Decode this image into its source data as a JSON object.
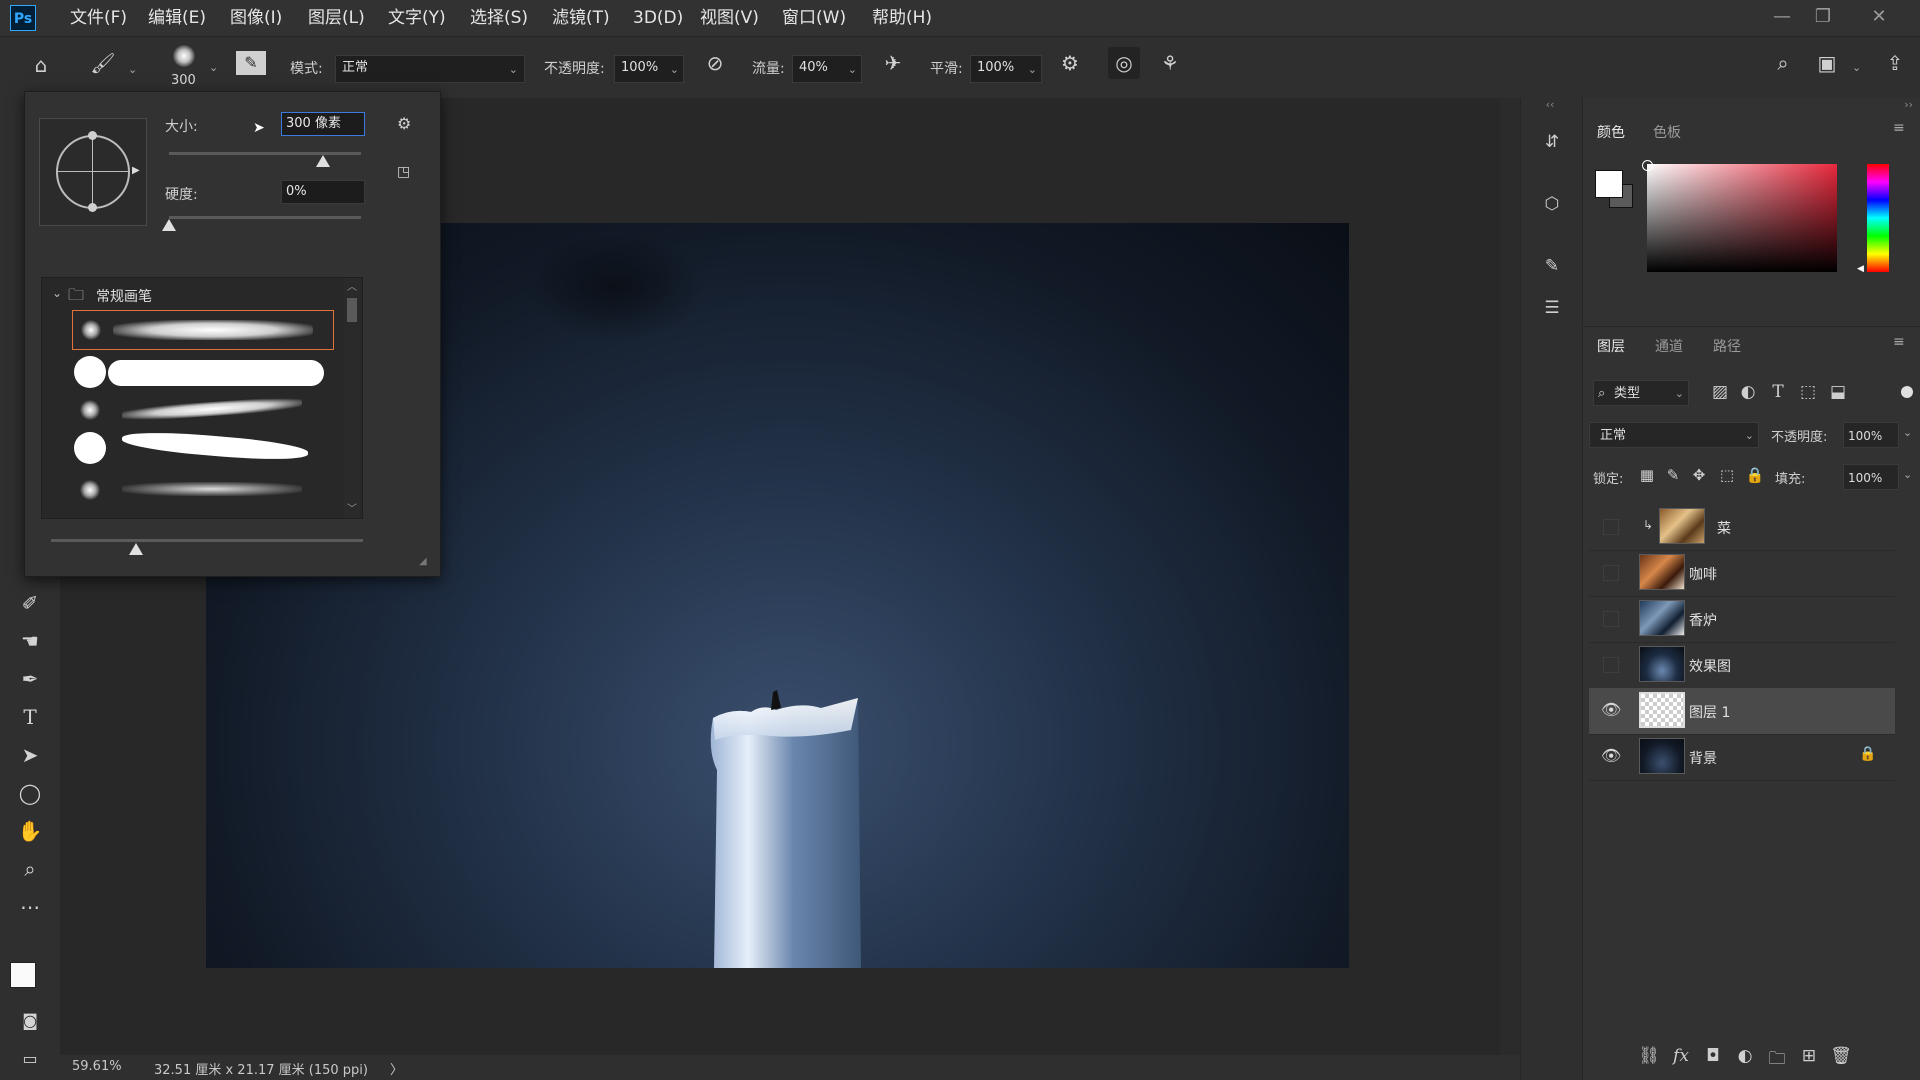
{
  "app": {
    "logo": "Ps"
  },
  "menu": [
    "文件(F)",
    "编辑(E)",
    "图像(I)",
    "图层(L)",
    "文字(Y)",
    "选择(S)",
    "滤镜(T)",
    "3D(D)",
    "视图(V)",
    "窗口(W)",
    "帮助(H)"
  ],
  "window_controls": {
    "minimize": "—",
    "restore": "❐",
    "close": "✕"
  },
  "options": {
    "brush_size": "300",
    "mode_label": "模式:",
    "mode_value": "正常",
    "opacity_label": "不透明度:",
    "opacity_value": "100%",
    "flow_label": "流量:",
    "flow_value": "40%",
    "smoothing_label": "平滑:",
    "smoothing_value": "100%"
  },
  "brush_panel": {
    "size_label": "大小:",
    "size_value": "300 像素",
    "size_fraction": 0.8,
    "hardness_label": "硬度:",
    "hardness_value": "0%",
    "hardness_fraction": 0.0,
    "folder_name": "常规画笔"
  },
  "status": {
    "zoom": "59.61%",
    "doc_info": "32.51 厘米 x 21.17 厘米 (150 ppi)",
    "arrow": "〉"
  },
  "color_panel": {
    "tabs": [
      "颜色",
      "色板"
    ],
    "active_tab": "颜色",
    "accent_hue": "#e8283c"
  },
  "layers_panel": {
    "tabs": [
      "图层",
      "通道",
      "路径"
    ],
    "active_tab": "图层",
    "filter_label": "类型",
    "blend_mode": "正常",
    "opacity_label": "不透明度:",
    "opacity_value": "100%",
    "lock_label": "锁定:",
    "fill_label": "填充:",
    "fill_value": "100%",
    "layers": [
      {
        "name": "菜",
        "visible": false,
        "clipped": true
      },
      {
        "name": "咖啡",
        "visible": false,
        "clipped": false
      },
      {
        "name": "香炉",
        "visible": false,
        "clipped": false
      },
      {
        "name": "效果图",
        "visible": false,
        "clipped": false
      },
      {
        "name": "图层 1",
        "visible": true,
        "selected": true
      },
      {
        "name": "背景",
        "visible": true,
        "locked": true
      }
    ]
  }
}
